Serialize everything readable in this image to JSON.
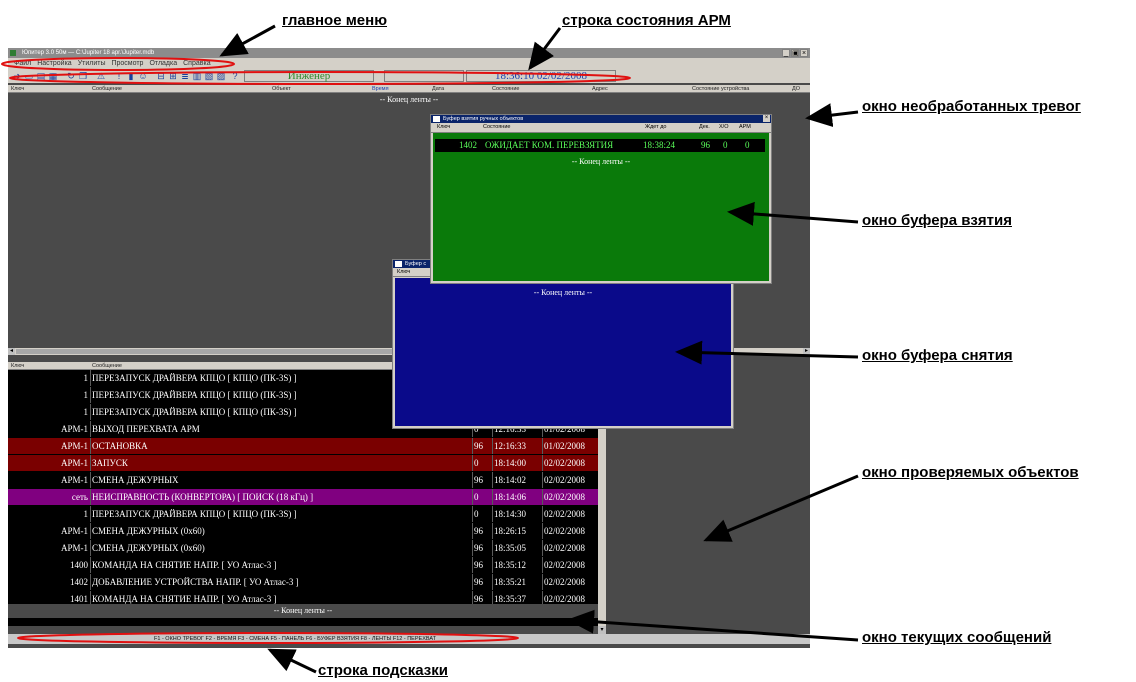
{
  "window": {
    "title": "Юпитер 3.0 50м — C:\\Jupiter 18 apr.\\Jupiter.mdb",
    "controls": [
      "_",
      "▣",
      "×"
    ]
  },
  "menu": [
    "Файл",
    "Настройка",
    "Утилиты",
    "Просмотр",
    "Отладка",
    "Справка"
  ],
  "status": {
    "operator": "Инженер",
    "datetime": "18:36:10 02/02/2008",
    "operator_color": "#2e8b2e",
    "datetime_color": "#1a3fb0"
  },
  "alarms_window": {
    "columns": [
      "Ключ",
      "Сообщение",
      "Объект",
      "Время",
      "Дата",
      "Состояние",
      "Адрес",
      "Состояние устройства",
      "ДО"
    ],
    "end_text": "-- Конец ленты --"
  },
  "capture_buffer": {
    "title": "Буфер взятия ручных объектов",
    "columns": [
      "Ключ",
      "Состояние",
      "Ждет до",
      "Дек.",
      "Х/О",
      "АРМ"
    ],
    "row": {
      "key": "1402",
      "state": "ОЖИДАЕТ КОМ. ПЕРЕВЗЯТИЯ",
      "wait": "18:38:24",
      "dec": "96",
      "xo": "0",
      "arm": "0"
    },
    "end_text": "-- Конец ленты --",
    "bg": "#0a7a0a"
  },
  "release_buffer": {
    "title": "Буфер с",
    "column": "Ключ",
    "end_text": "-- Конец ленты --",
    "bg": "#0a0a8a"
  },
  "messages_window": {
    "columns": [
      "Ключ",
      "Сообщение"
    ],
    "rows": [
      {
        "key": "1",
        "text": "ПЕРЕЗАПУСК ДРАЙВЕРА КПЦО [ КПЦО (ПК-3S) ]",
        "dev": "",
        "time": "",
        "date": "",
        "bg": "#000000"
      },
      {
        "key": "1",
        "text": "ПЕРЕЗАПУСК ДРАЙВЕРА КПЦО [ КПЦО (ПК-3S) ]",
        "dev": "",
        "time": "",
        "date": "",
        "bg": "#000000"
      },
      {
        "key": "1",
        "text": "ПЕРЕЗАПУСК ДРАЙВЕРА КПЦО [ КПЦО (ПК-3S) ]",
        "dev": "",
        "time": "",
        "date": "",
        "bg": "#000000"
      },
      {
        "key": "АРМ-1",
        "text": "ВЫХОД ПЕРЕХВАТА АРМ",
        "dev": "0",
        "time": "12:16:33",
        "date": "01/02/2008",
        "bg": "#000000"
      },
      {
        "key": "АРМ-1",
        "text": "ОСТАНОВКА",
        "dev": "96",
        "time": "12:16:33",
        "date": "01/02/2008",
        "bg": "#7a0000"
      },
      {
        "key": "АРМ-1",
        "text": "ЗАПУСК",
        "dev": "0",
        "time": "18:14:00",
        "date": "02/02/2008",
        "bg": "#7a0000"
      },
      {
        "key": "АРМ-1",
        "text": "СМЕНА ДЕЖУРНЫХ",
        "dev": "96",
        "time": "18:14:02",
        "date": "02/02/2008",
        "bg": "#000000"
      },
      {
        "key": "сеть",
        "text": "НЕИСПРАВНОСТЬ (КОНВЕРТОРА) [ ПОИСК (18 кГц) ]",
        "dev": "0",
        "time": "18:14:06",
        "date": "02/02/2008",
        "bg": "#800080"
      },
      {
        "key": "1",
        "text": "ПЕРЕЗАПУСК ДРАЙВЕРА КПЦО [ КПЦО (ПК-3S) ]",
        "dev": "0",
        "time": "18:14:30",
        "date": "02/02/2008",
        "bg": "#000000"
      },
      {
        "key": "АРМ-1",
        "text": "СМЕНА ДЕЖУРНЫХ  (0x60)",
        "dev": "96",
        "time": "18:26:15",
        "date": "02/02/2008",
        "bg": "#000000"
      },
      {
        "key": "АРМ-1",
        "text": "СМЕНА ДЕЖУРНЫХ  (0x60)",
        "dev": "96",
        "time": "18:35:05",
        "date": "02/02/2008",
        "bg": "#000000"
      },
      {
        "key": "1400",
        "text": "КОМАНДА НА СНЯТИЕ  НАПР. [ УО Атлас-3 ]",
        "dev": "96",
        "time": "18:35:12",
        "date": "02/02/2008",
        "bg": "#000000"
      },
      {
        "key": "1402",
        "text": "ДОБАВЛЕНИЕ УСТРОЙСТВА НАПР. [ УО Атлас-3 ]",
        "dev": "96",
        "time": "18:35:21",
        "date": "02/02/2008",
        "bg": "#000000"
      },
      {
        "key": "1401",
        "text": "КОМАНДА НА СНЯТИЕ  НАПР. [ УО Атлас-3 ]",
        "dev": "96",
        "time": "18:35:37",
        "date": "02/02/2008",
        "bg": "#000000"
      }
    ],
    "end_text": "-- Конец ленты --"
  },
  "hint_bar": "F1 - ОКНО ТРЕВОГ   F2 - ВРЕМЯ   F3 - СМЕНА   F5 - ПАНЕЛЬ   F6 - БУФЕР ВЗЯТИЯ   F8 - ЛЕНТЫ   F12 - ПЕРЕХВАТ",
  "annotations": {
    "main_menu": "главное меню",
    "status_line": "строка состояния АРМ",
    "alarms": "окно необработанных тревог",
    "capture_buffer": "окно буфера взятия",
    "release_buffer": "окно буфера снятия",
    "checked_objects": "окно проверяемых объектов",
    "current_messages": "окно текущих сообщений",
    "hint_line": "строка подсказки"
  }
}
